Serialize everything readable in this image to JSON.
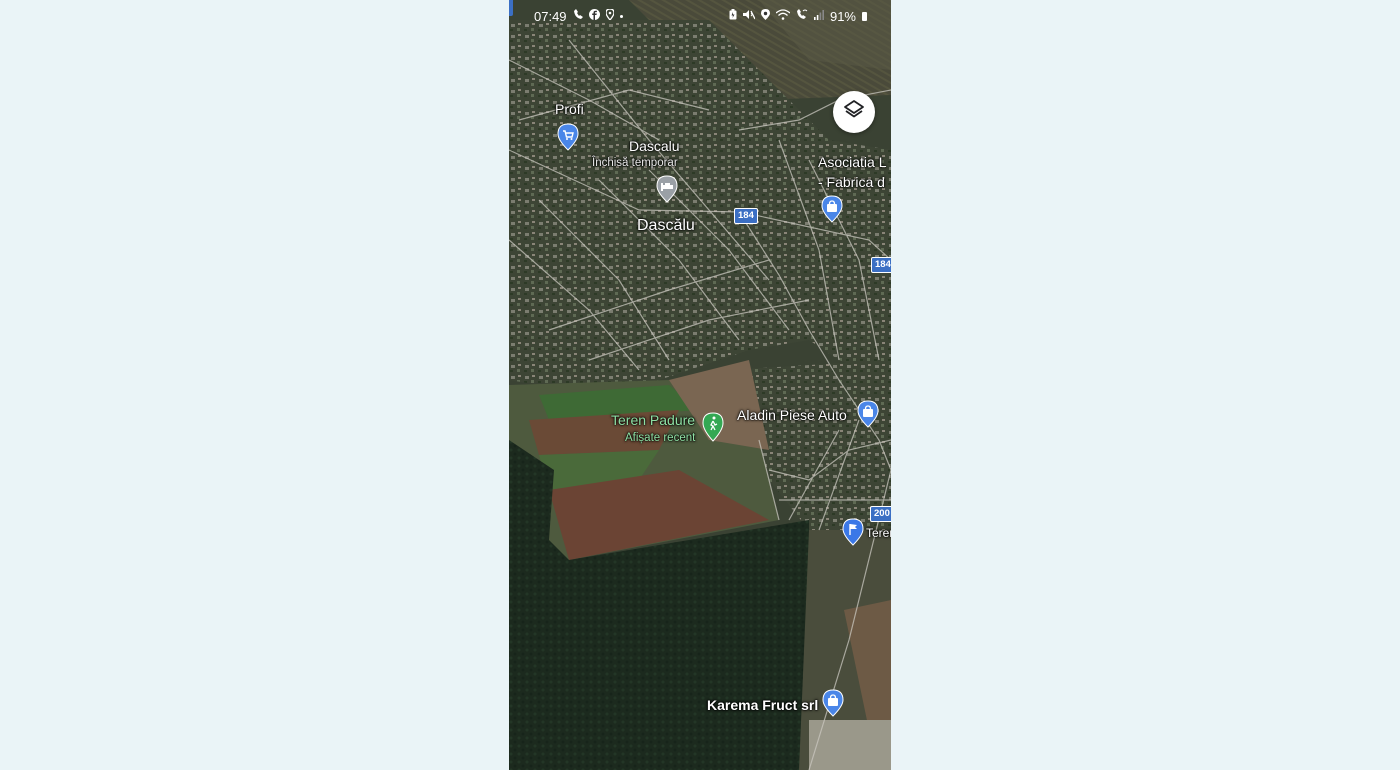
{
  "status_bar": {
    "time": "07:49",
    "left_icons": [
      "missed-call-icon",
      "facebook-icon",
      "map-pin-icon",
      "dot"
    ],
    "right_icons": [
      "battery-saver-icon",
      "mute-icon",
      "location-icon",
      "wifi-icon",
      "wifi-calling-icon",
      "signal-icon"
    ],
    "battery_percent": "91%"
  },
  "map": {
    "layers_button_icon": "layers-icon",
    "labels": {
      "profi": "Profi",
      "dascalu_place": "Dascalu",
      "dascalu_status": "Închisă temporar",
      "dascalu_town": "Dascălu",
      "asociatia_line1": "Asociatia L",
      "asociatia_line2": "- Fabrica d",
      "teren_padure": "Teren Padure",
      "teren_padure_sub": "Afișate recent",
      "aladin": "Aladin Piese Auto",
      "teren_right": "Teren",
      "karema": "Karema Fruct srl"
    },
    "road_shields": {
      "r184_a": "184",
      "r184_b": "184",
      "r200": "200"
    },
    "colors": {
      "shopping_pin": "#4a86e8",
      "hotel_pin": "#9aa0a6",
      "hiking_pin": "#34a853",
      "flag_pin": "#3b78e7"
    }
  }
}
